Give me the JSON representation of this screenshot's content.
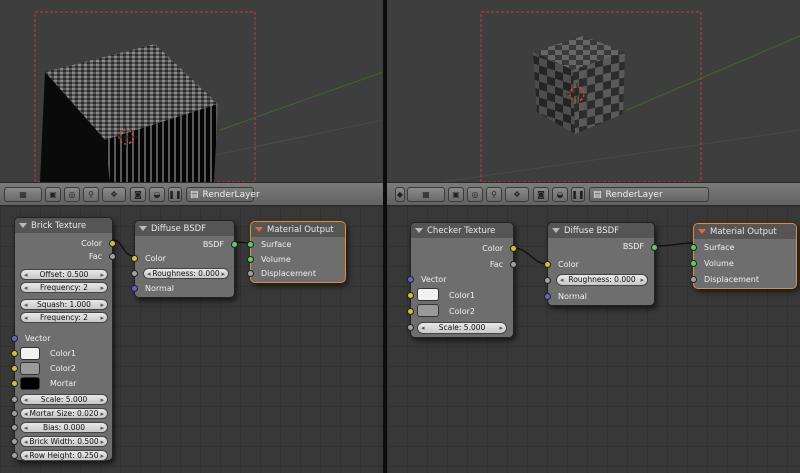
{
  "left": {
    "header": {
      "render_layer_label": "RenderLayer"
    },
    "nodes": {
      "brick_texture": {
        "title": "Brick Texture",
        "outputs": [
          "Color",
          "Fac"
        ],
        "fields": [
          "Offset: 0.500",
          "Frequency: 2",
          "Squash: 1.000",
          "Frequency: 2"
        ],
        "inputs": {
          "vector": "Vector",
          "color1": "Color1",
          "color2": "Color2",
          "mortar": "Mortar"
        },
        "params": [
          "Scale: 5.000",
          "Mortar Size: 0.020",
          "Bias: 0.000",
          "Brick Width: 0.500",
          "Row Height: 0.250"
        ],
        "colors": {
          "color1": "#f2f2f2",
          "color2": "#9a9a9a",
          "mortar": "#000000"
        }
      },
      "diffuse_bsdf": {
        "title": "Diffuse BSDF",
        "output": "BSDF",
        "inputs": [
          "Color",
          "Normal"
        ],
        "roughness": "Roughness: 0.000"
      },
      "material_output": {
        "title": "Material Output",
        "inputs": [
          "Surface",
          "Volume",
          "Displacement"
        ]
      }
    }
  },
  "right": {
    "header": {
      "render_layer_label": "RenderLayer"
    },
    "nodes": {
      "checker_texture": {
        "title": "Checker Texture",
        "outputs": [
          "Color",
          "Fac"
        ],
        "inputs": {
          "vector": "Vector",
          "color1": "Color1",
          "color2": "Color2"
        },
        "scale": "Scale: 5.000",
        "colors": {
          "color1": "#f2f2f2",
          "color2": "#9a9a9a"
        }
      },
      "diffuse_bsdf": {
        "title": "Diffuse BSDF",
        "output": "BSDF",
        "inputs": [
          "Color",
          "Normal"
        ],
        "roughness": "Roughness: 0.000"
      },
      "material_output": {
        "title": "Material Output",
        "inputs": [
          "Surface",
          "Volume",
          "Displacement"
        ]
      }
    }
  },
  "theme": {
    "socket_color": "#c7c729",
    "socket_shader": "#63c763",
    "socket_vector": "#6363c7",
    "socket_value": "#a1a1a1",
    "active_node_border": "#e0902a"
  },
  "icons": [
    "view-type-icon",
    "sphere-preview-icon",
    "material-icon",
    "pin-icon",
    "render-icon",
    "world-icon",
    "pause-icon",
    "render-layer-icon"
  ]
}
